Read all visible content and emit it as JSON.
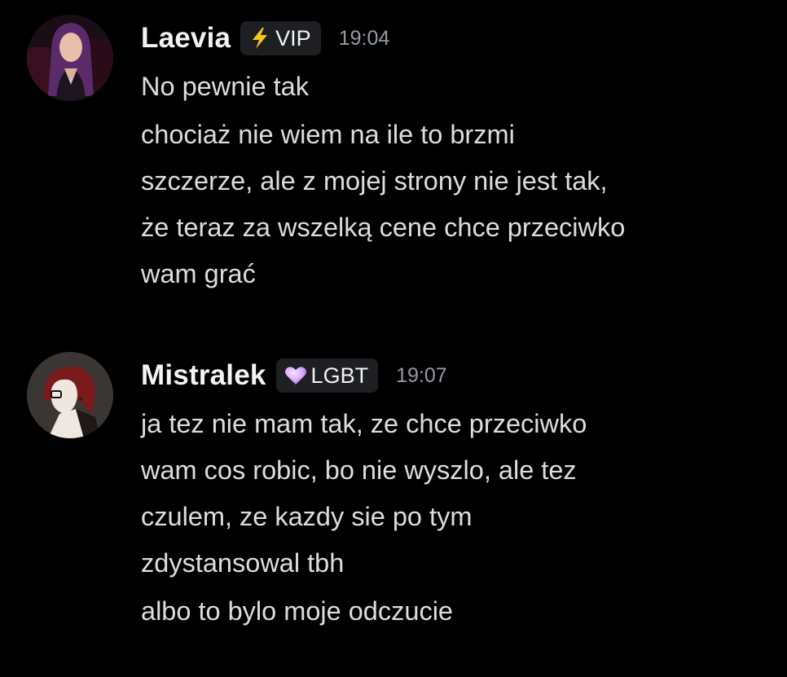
{
  "messages": [
    {
      "username": "Laevia",
      "role": {
        "icon": "lightning-bolt-icon",
        "label": "VIP",
        "color": "#f5c518"
      },
      "timestamp": "19:04",
      "lines": [
        "No pewnie tak",
        "chociaż nie wiem na ile to brzmi\nszczerze, ale z mojej strony nie jest tak,\nże teraz za wszelką cene chce przeciwko\nwam grać"
      ]
    },
    {
      "username": "Mistralek",
      "role": {
        "icon": "purple-heart-icon",
        "label": "LGBT",
        "color": "#d8a6ff"
      },
      "timestamp": "19:07",
      "lines": [
        "ja tez nie mam tak, ze chce przeciwko\nwam cos robic, bo nie wyszlo, ale tez\nczulem, ze kazdy sie po tym\nzdystansowal tbh",
        "albo to bylo moje odczucie"
      ]
    }
  ]
}
